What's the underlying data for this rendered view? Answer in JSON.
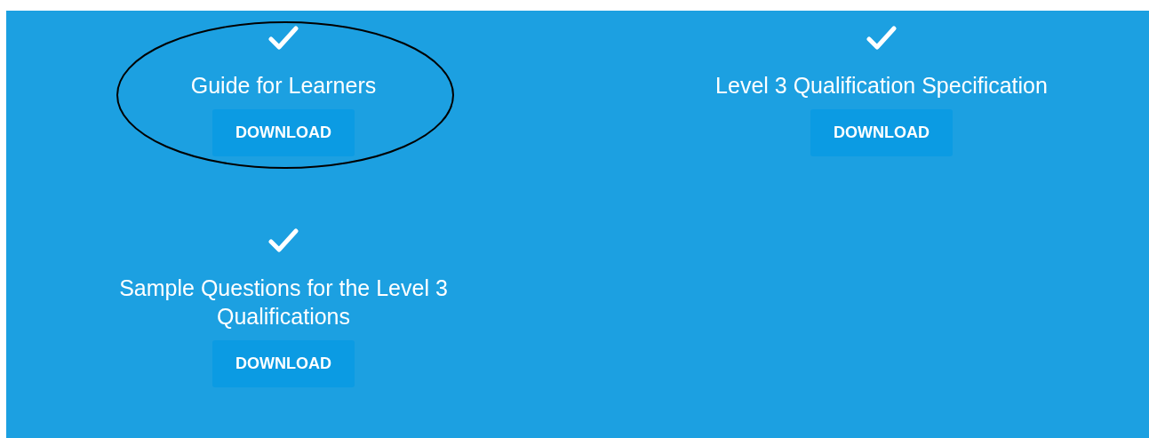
{
  "downloads": [
    {
      "title": "Guide for Learners",
      "checked": true,
      "button": "DOWNLOAD",
      "highlighted": true
    },
    {
      "title": "Level 3 Qualification Specification",
      "checked": true,
      "button": "DOWNLOAD",
      "highlighted": false
    },
    {
      "title": "Sample Questions for the Level 3 Qualifications",
      "checked": true,
      "button": "DOWNLOAD",
      "highlighted": false
    }
  ]
}
